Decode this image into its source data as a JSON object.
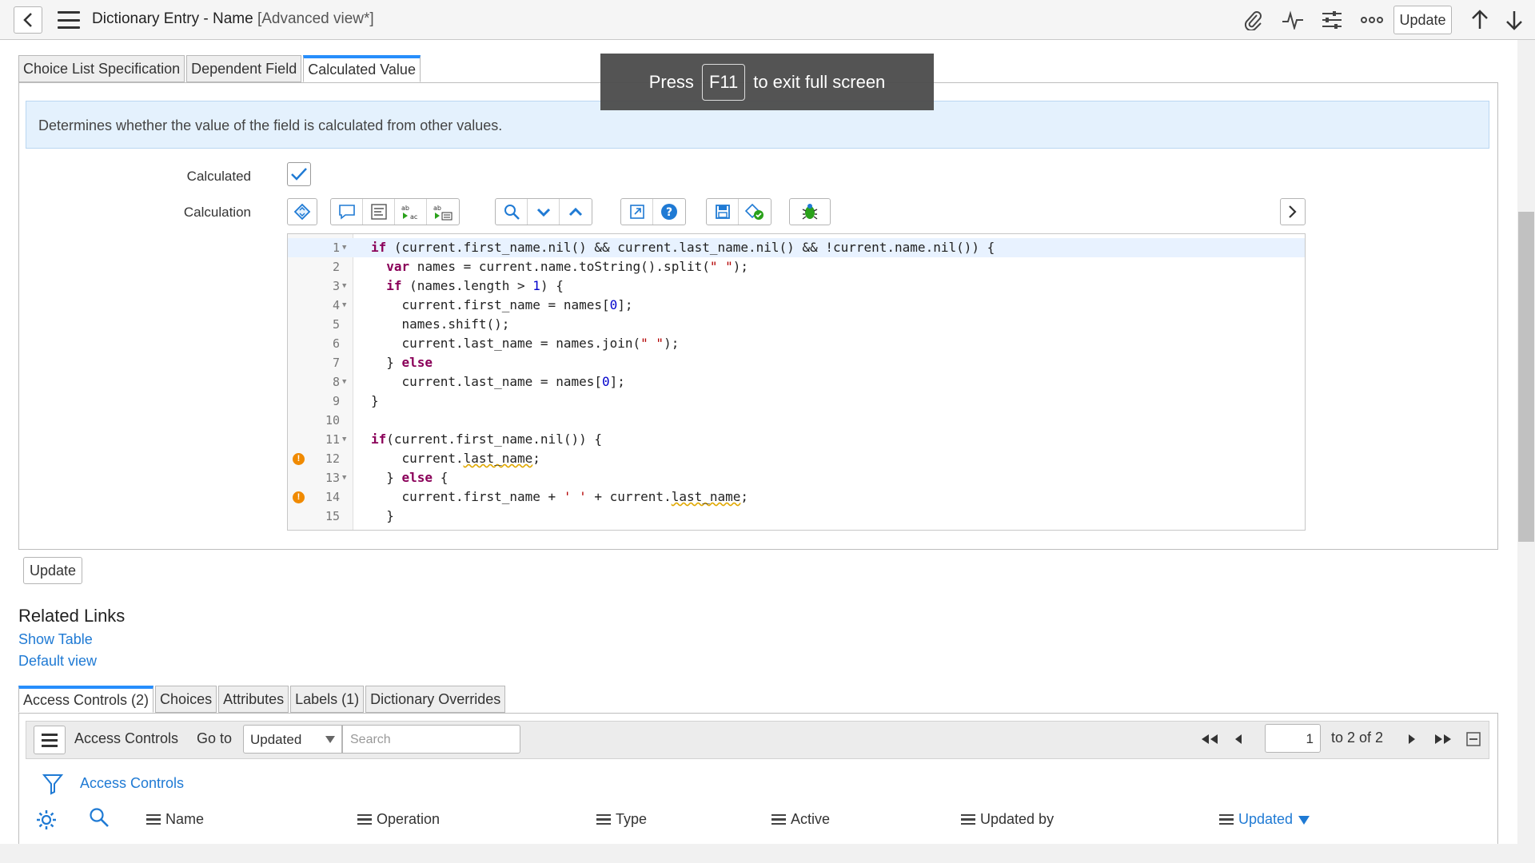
{
  "header": {
    "title": "Dictionary Entry - Name",
    "view": "[Advanced view*]",
    "update_label": "Update"
  },
  "form_tabs": [
    {
      "label": "Choice List Specification",
      "active": false
    },
    {
      "label": "Dependent Field",
      "active": false
    },
    {
      "label": "Calculated Value",
      "active": true
    }
  ],
  "info_text": "Determines whether the value of the field is calculated from other values.",
  "fields": {
    "calculated_label": "Calculated",
    "calculated_checked": true,
    "calculation_label": "Calculation"
  },
  "code_lines": [
    "if (current.first_name.nil() && current.last_name.nil() && !current.name.nil()) {",
    "  var names = current.name.toString().split(\" \");",
    "  if (names.length > 1) {",
    "    current.first_name = names[0];",
    "    names.shift();",
    "    current.last_name = names.join(\" \");",
    "  } else",
    "    current.last_name = names[0];",
    "}",
    "",
    "if(current.first_name.nil()) {",
    "    current.last_name;",
    "  } else {",
    "    current.first_name + ' ' + current.last_name;",
    "  }"
  ],
  "update_button": "Update",
  "related_links": {
    "title": "Related Links",
    "links": [
      "Show Table",
      "Default view"
    ]
  },
  "related_tabs": [
    {
      "label": "Access Controls (2)",
      "active": true
    },
    {
      "label": "Choices",
      "active": false
    },
    {
      "label": "Attributes",
      "active": false
    },
    {
      "label": "Labels (1)",
      "active": false
    },
    {
      "label": "Dictionary Overrides",
      "active": false
    }
  ],
  "list": {
    "title": "Access Controls",
    "goto_label": "Go to",
    "goto_value": "Updated",
    "search_placeholder": "Search",
    "page_value": "1",
    "page_text": "to 2 of 2",
    "breadcrumb": "Access Controls",
    "columns": [
      "Name",
      "Operation",
      "Type",
      "Active",
      "Updated by",
      "Updated"
    ]
  },
  "fullscreen": {
    "press": "Press",
    "key": "F11",
    "rest": "to exit full screen"
  },
  "colors": {
    "accent": "#278efc",
    "link": "#1f7ad4",
    "warning": "#f08a00"
  }
}
